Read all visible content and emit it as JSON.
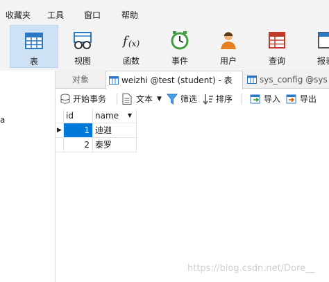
{
  "menu": [
    "收藏夹",
    "工具",
    "窗口",
    "帮助"
  ],
  "ribbon": [
    {
      "label": "表",
      "icon": "table-icon",
      "active": true
    },
    {
      "label": "视图",
      "icon": "view-icon",
      "active": false
    },
    {
      "label": "函数",
      "icon": "function-icon",
      "active": false
    },
    {
      "label": "事件",
      "icon": "clock-icon",
      "active": false
    },
    {
      "label": "用户",
      "icon": "user-icon",
      "active": false
    },
    {
      "label": "查询",
      "icon": "query-icon",
      "active": false
    },
    {
      "label": "报表",
      "icon": "report-icon",
      "active": false
    }
  ],
  "left_fragment": "a",
  "tabs": [
    {
      "label": "对象"
    },
    {
      "label": "weizhi @test (student) - 表"
    },
    {
      "label": "sys_config @sys (s"
    }
  ],
  "toolbar": {
    "begin_transaction": "开始事务",
    "text": "文本",
    "filter": "筛选",
    "sort": "排序",
    "import": "导入",
    "export": "导出"
  },
  "grid": {
    "columns": [
      "id",
      "name"
    ],
    "rows": [
      {
        "id": "1",
        "name": "迪迦"
      },
      {
        "id": "2",
        "name": "泰罗"
      }
    ]
  },
  "watermark": "https://blog.csdn.net/Dore__",
  "colors": {
    "accent": "#0078d7",
    "active_button_bg": "#cfe2f5",
    "menubar_bg": "#f3f3f3"
  }
}
